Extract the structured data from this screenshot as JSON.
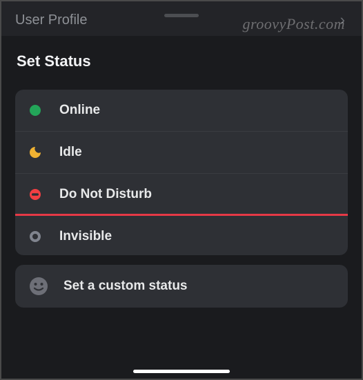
{
  "header": {
    "title": "User Profile"
  },
  "sheet": {
    "title": "Set Status"
  },
  "statuses": [
    {
      "label": "Online"
    },
    {
      "label": "Idle"
    },
    {
      "label": "Do Not Disturb"
    },
    {
      "label": "Invisible"
    }
  ],
  "custom": {
    "label": "Set a custom status"
  },
  "watermark": "groovyPost.com",
  "colors": {
    "online": "#23a559",
    "idle": "#f0b232",
    "dnd": "#f23f43",
    "invisible": "#80848e"
  }
}
